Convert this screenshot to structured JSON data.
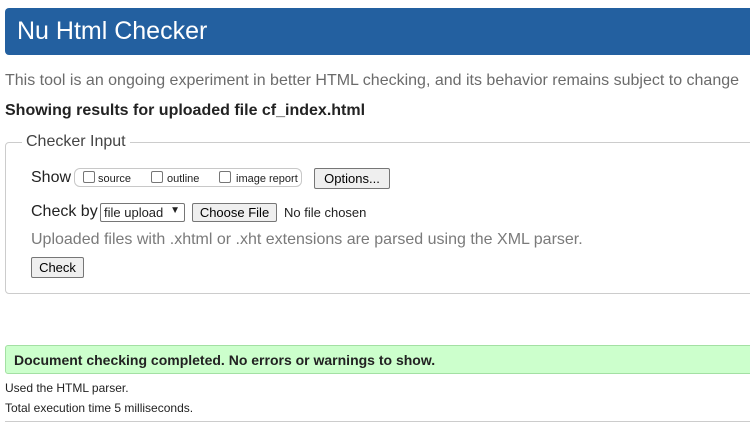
{
  "header": {
    "title": "Nu Html Checker"
  },
  "tagline": "This tool is an ongoing experiment in better HTML checking, and its behavior remains subject to change",
  "results_heading": "Showing results for uploaded file cf_index.html",
  "checker_input": {
    "legend": "Checker Input",
    "show_label": "Show",
    "show_options": [
      {
        "label": "source",
        "checked": false
      },
      {
        "label": "outline",
        "checked": false
      },
      {
        "label": "image report",
        "checked": false
      }
    ],
    "options_button": "Options...",
    "check_by_label": "Check by",
    "check_by_select": {
      "selected": "file upload"
    },
    "choose_file_button": "Choose File",
    "file_status": "No file chosen",
    "hint": "Uploaded files with .xhtml or .xht extensions are parsed using the XML parser.",
    "check_button": "Check"
  },
  "result": {
    "message": "Document checking completed. No errors or warnings to show.",
    "accent_color": "#ccffcc"
  },
  "footer_notes": {
    "parser": "Used the HTML parser.",
    "timing": "Total execution time 5 milliseconds."
  },
  "colors": {
    "header_bg": "#2360a0",
    "success_bg": "#ccffcc"
  }
}
